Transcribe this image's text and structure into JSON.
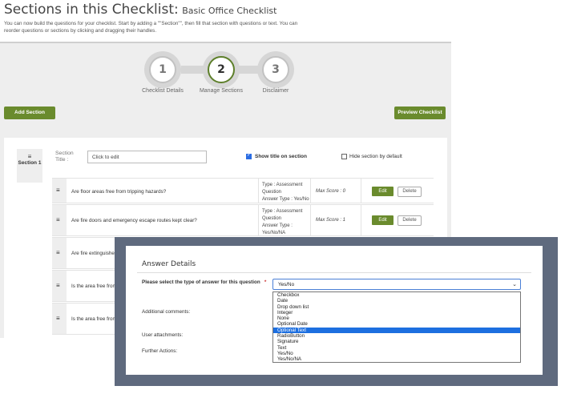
{
  "page": {
    "title_main": "Sections in this Checklist:",
    "title_sub": "Basic Office Checklist",
    "intro": "You can now build the questions for your checklist. Start by adding a \"\"Section\"\", then fill that section with questions or text. You can reorder questions or sections by clicking and dragging their handles."
  },
  "wizard": {
    "steps": [
      {
        "number": "1",
        "label": "Checklist Details"
      },
      {
        "number": "2",
        "label": "Manage Sections",
        "active": true
      },
      {
        "number": "3",
        "label": "Disclaimer"
      }
    ]
  },
  "toolbar": {
    "add_section": "Add Section",
    "preview_checklist": "Preview Checklist"
  },
  "section": {
    "side_label": "Section 1",
    "title_label": "Section Title :",
    "title_input": "Click to edit",
    "show_title_label": "Show title on section",
    "show_title_checked": true,
    "hide_default_label": "Hide section by default",
    "hide_default_checked": false
  },
  "questions": [
    {
      "text": "Are floor areas free from tripping hazards?",
      "type": "Type : Assessment Question",
      "answer": "Answer Type : Yes/No",
      "score": "Max Score : 0",
      "edit": "Edit",
      "delete": "Delete"
    },
    {
      "text": "Are fire doors and emergency escape routes kept clear?",
      "type": "Type : Assessment Question",
      "answer": "Answer Type : Yes/No/NA",
      "score": "Max Score : 1",
      "edit": "Edit",
      "delete": "Delete"
    },
    {
      "text": "Are fire extinguisher"
    },
    {
      "text": "Is the area free from"
    },
    {
      "text": "Is the area free from"
    }
  ],
  "modal": {
    "title": "Answer Details",
    "answer_type_label": "Please select the type of answer for this question",
    "required_mark": "*",
    "selected_value": "Yes/No",
    "additional_comments_label": "Additional comments:",
    "user_attachments_label": "User attachments:",
    "further_actions_label": "Further Actions:",
    "options": [
      "Checkbox",
      "Date",
      "Drop down list",
      "Integer",
      "None",
      "Optional Date",
      "Optional Text",
      "RadioButton",
      "Signature",
      "Text",
      "Yes/No",
      "Yes/No/NA"
    ],
    "highlighted_option": "Optional Text"
  },
  "colors": {
    "accent_green": "#6a8b2d",
    "overlay": "#5f6a7e",
    "highlight_blue": "#1d6fe0"
  }
}
